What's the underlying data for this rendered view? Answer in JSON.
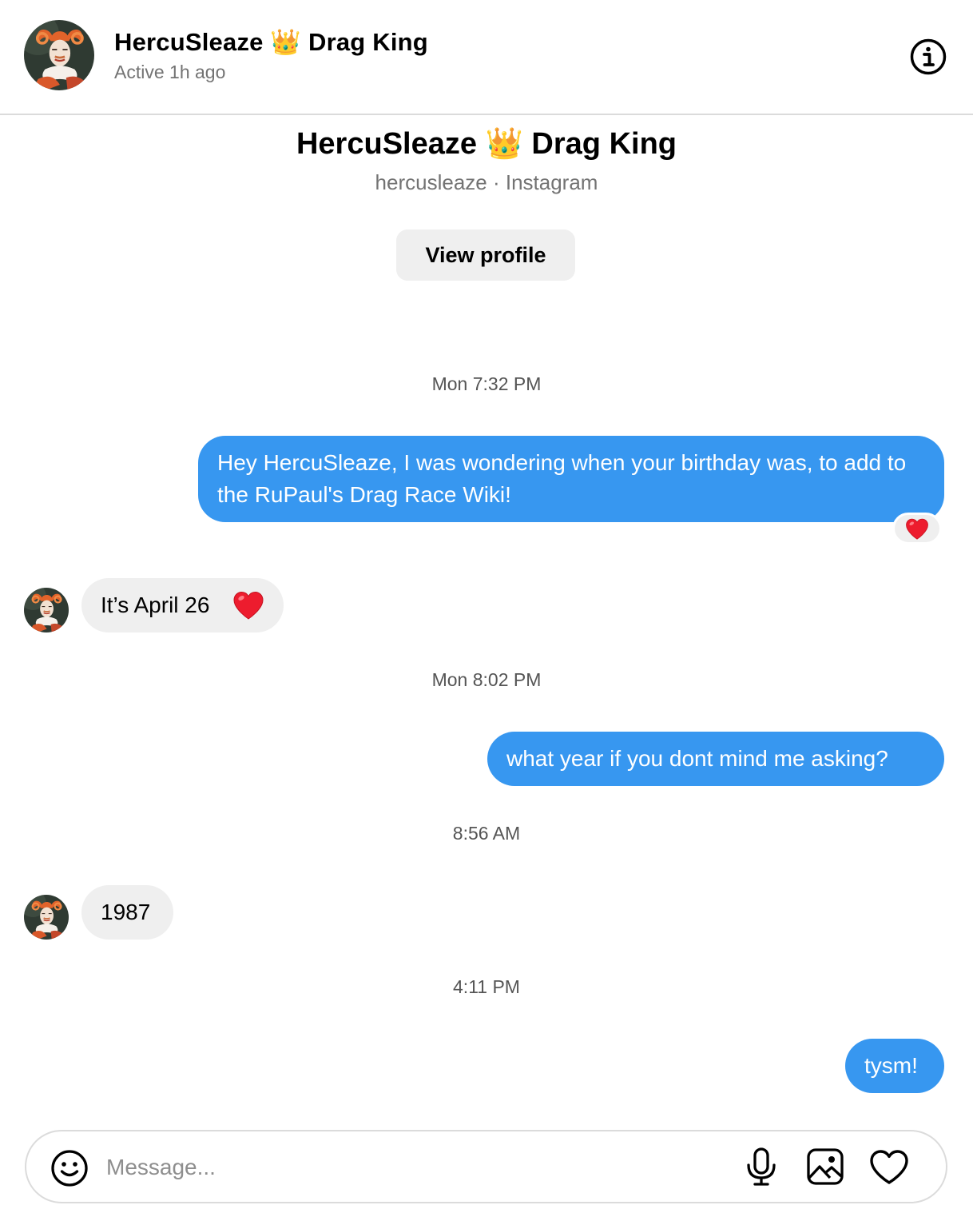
{
  "header": {
    "name": "HercuSleaze 👑 Drag King",
    "status": "Active 1h ago"
  },
  "profile": {
    "name": "HercuSleaze 👑 Drag King",
    "subtitle": "hercusleaze · Instagram",
    "view_profile_label": "View profile"
  },
  "conversation": {
    "ts1": "Mon 7:32 PM",
    "msg1": "Hey HercuSleaze, I was wondering when your birthday was, to add to the RuPaul's Drag Race Wiki!",
    "reaction1": "❤️",
    "msg2": "It’s April 26",
    "ts2": "Mon 8:02 PM",
    "msg3": "what year if you dont mind me asking?",
    "ts3": "8:56 AM",
    "msg4": "1987",
    "ts4": "4:11 PM",
    "msg5": "tysm!"
  },
  "composer": {
    "placeholder": "Message..."
  },
  "colors": {
    "outgoing_bubble": "#3797f0",
    "incoming_bubble": "#efefef",
    "heart": "#ed1c2e"
  },
  "icons": [
    "info-icon",
    "emoji-icon",
    "microphone-icon",
    "image-icon",
    "heart-icon"
  ]
}
